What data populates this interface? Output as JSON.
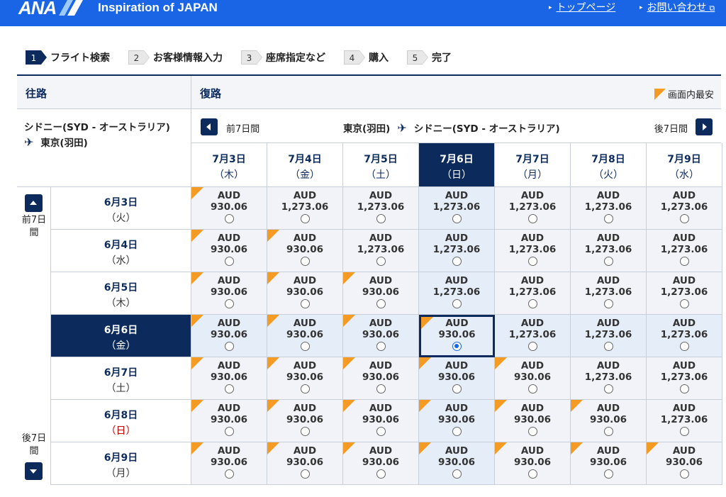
{
  "header": {
    "logo": "ANA",
    "tagline": "Inspiration of JAPAN",
    "links": {
      "top_page": "トップページ",
      "contact": "お問い合わせ"
    },
    "brand_color": "#1a64e6"
  },
  "steps": [
    {
      "num": "1",
      "label": "フライト検索",
      "active": true
    },
    {
      "num": "2",
      "label": "お客様情報入力",
      "active": false
    },
    {
      "num": "3",
      "label": "座席指定など",
      "active": false
    },
    {
      "num": "4",
      "label": "購入",
      "active": false
    },
    {
      "num": "5",
      "label": "完了",
      "active": false
    }
  ],
  "outbound": {
    "title": "往路",
    "from": "シドニー(SYD - オーストラリア)",
    "to": "東京(羽田)",
    "prev_label": "前7日\n間",
    "next_label": "後7日\n間"
  },
  "return": {
    "title": "復路",
    "legend": "画面内最安",
    "prev_label": "前7日間",
    "next_label": "後7日間",
    "from": "東京(羽田)",
    "to": "シドニー(SYD - オーストラリア)"
  },
  "return_dates": [
    {
      "date": "7月3日",
      "day": "（木）"
    },
    {
      "date": "7月4日",
      "day": "（金）"
    },
    {
      "date": "7月5日",
      "day": "（土）"
    },
    {
      "date": "7月6日",
      "day": "（日）",
      "selected": true
    },
    {
      "date": "7月7日",
      "day": "（月）"
    },
    {
      "date": "7月8日",
      "day": "（火）"
    },
    {
      "date": "7月9日",
      "day": "（水）"
    }
  ],
  "outbound_dates": [
    {
      "date": "6月3日",
      "day": "（火）"
    },
    {
      "date": "6月4日",
      "day": "（水）"
    },
    {
      "date": "6月5日",
      "day": "（木）"
    },
    {
      "date": "6月6日",
      "day": "（金）",
      "selected": true
    },
    {
      "date": "6月7日",
      "day": "（土）"
    },
    {
      "date": "6月8日",
      "day": "（日）",
      "sunday": true
    },
    {
      "date": "6月9日",
      "day": "（月）"
    }
  ],
  "currency": "AUD",
  "fares": [
    [
      "930.06",
      "1,273.06",
      "1,273.06",
      "1,273.06",
      "1,273.06",
      "1,273.06",
      "1,273.06"
    ],
    [
      "930.06",
      "930.06",
      "1,273.06",
      "1,273.06",
      "1,273.06",
      "1,273.06",
      "1,273.06"
    ],
    [
      "930.06",
      "930.06",
      "930.06",
      "1,273.06",
      "1,273.06",
      "1,273.06",
      "1,273.06"
    ],
    [
      "930.06",
      "930.06",
      "930.06",
      "930.06",
      "1,273.06",
      "1,273.06",
      "1,273.06"
    ],
    [
      "930.06",
      "930.06",
      "930.06",
      "930.06",
      "930.06",
      "1,273.06",
      "1,273.06"
    ],
    [
      "930.06",
      "930.06",
      "930.06",
      "930.06",
      "930.06",
      "930.06",
      "1,273.06"
    ],
    [
      "930.06",
      "930.06",
      "930.06",
      "930.06",
      "930.06",
      "930.06",
      "930.06"
    ]
  ],
  "selected": {
    "row": 3,
    "col": 3
  },
  "colors": {
    "navy": "#0c2b5c",
    "cheapest_flag": "#f59a23"
  }
}
